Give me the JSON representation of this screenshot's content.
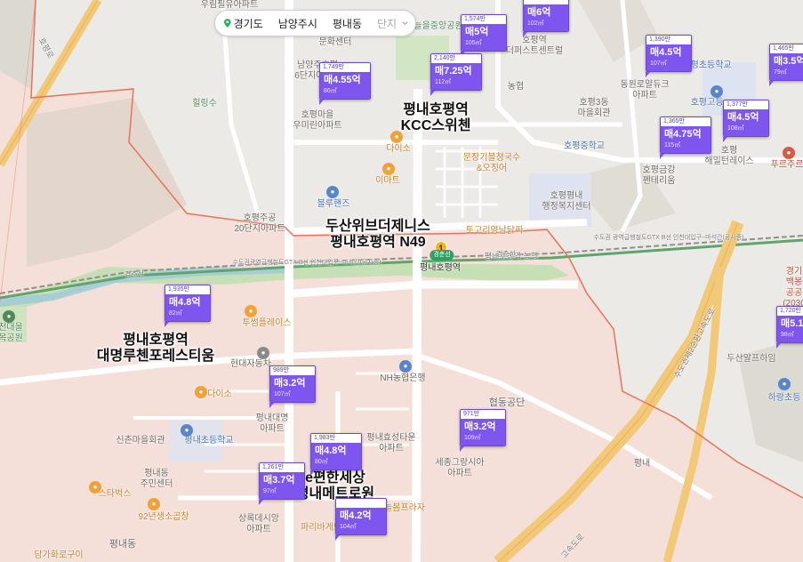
{
  "breadcrumb": {
    "items": [
      "경기도",
      "남양주시",
      "평내동"
    ],
    "complex_select": "단지"
  },
  "colors": {
    "marker": "#7e55ee",
    "boundary": "#e8735c",
    "highway": "#f2c879"
  },
  "complexes": [
    {
      "name": "평내호평역\nKCC스위첸"
    },
    {
      "name": "두산위브더제니스\n평내호평역 N49"
    },
    {
      "name": "평내호평역\n대명루첸포레스티움"
    },
    {
      "name": "e편한세상\n평내메트로원"
    }
  ],
  "listings": [
    {
      "id": "m1",
      "unit": "1,574만",
      "price": "매5억",
      "area": "105㎡"
    },
    {
      "id": "m2",
      "unit": "",
      "price": "매6억",
      "area": "102㎡"
    },
    {
      "id": "m3",
      "unit": "1,749만",
      "price": "매4.55억",
      "area": "86㎡"
    },
    {
      "id": "m4",
      "unit": "2,140만",
      "price": "매7.25억",
      "area": "112㎡"
    },
    {
      "id": "m5",
      "unit": "1,390만",
      "price": "매4.5억",
      "area": "107㎡"
    },
    {
      "id": "m6",
      "unit": "1,465만",
      "price": "매3.5억",
      "area": "79㎡"
    },
    {
      "id": "m7",
      "unit": "1,377만",
      "price": "매4.5억",
      "area": "108㎡"
    },
    {
      "id": "m8",
      "unit": "1,365만",
      "price": "매4.75억",
      "area": "115㎡"
    },
    {
      "id": "m9",
      "unit": "1,935만",
      "price": "매4.8억",
      "area": "82㎡"
    },
    {
      "id": "m10",
      "unit": "1,720만",
      "price": "매5.1",
      "area": "98㎡"
    },
    {
      "id": "m11",
      "unit": "989만",
      "price": "매3.2억",
      "area": "107㎡"
    },
    {
      "id": "m12",
      "unit": "971만",
      "price": "매3.2억",
      "area": "109㎡"
    },
    {
      "id": "m13",
      "unit": "1,983만",
      "price": "매4.8억",
      "area": "80㎡"
    },
    {
      "id": "m14",
      "unit": "1,261만",
      "price": "매3.7억",
      "area": "97㎡"
    },
    {
      "id": "m15",
      "unit": "",
      "price": "매4.2억",
      "area": "104㎡"
    }
  ],
  "places": [
    {
      "text": "우림필유아파트"
    },
    {
      "text": "늘을중앙공원"
    },
    {
      "text": "문화센터"
    },
    {
      "text": "남양주호평\n6단지아파트"
    },
    {
      "text": "호평마을\n우미린아파트"
    },
    {
      "text": "힐링수"
    },
    {
      "text": "호평역\n더퍼스트센트럴"
    },
    {
      "text": "농협"
    },
    {
      "text": "호평3동\n마을회관"
    },
    {
      "text": "동원로얄듀크\n아파트"
    },
    {
      "text": "호평초등학교"
    },
    {
      "text": "호평고등"
    },
    {
      "text": "호평중학교"
    },
    {
      "text": "호평금강\n펜테리움"
    },
    {
      "text": "호평\n해밀턴레이스"
    },
    {
      "text": "다이소"
    },
    {
      "text": "이마트"
    },
    {
      "text": "문장기블쳥국수\n&오징어"
    },
    {
      "text": "블루핸즈"
    },
    {
      "text": "호평평내\n행정복지센터"
    },
    {
      "text": "호평주공\n20단지아파트"
    },
    {
      "text": "토고리영남닭짜"
    },
    {
      "text": "평내호평역"
    },
    {
      "text": "투썸플레이스"
    },
    {
      "text": "현대자동차"
    },
    {
      "text": "다이소"
    },
    {
      "text": "평내대명\n아파트"
    },
    {
      "text": "NH농협은행"
    },
    {
      "text": "평내효성타운\n아파트"
    },
    {
      "text": "협동공단"
    },
    {
      "text": "신촌마을회관"
    },
    {
      "text": "평내초등학교"
    },
    {
      "text": "평내동\n주민센터"
    },
    {
      "text": "세종그랑시아\n아파트"
    },
    {
      "text": "스타벅스"
    },
    {
      "text": "92년생소곱창"
    },
    {
      "text": "상록데시앙\n아파트"
    },
    {
      "text": "파리바게뜨"
    },
    {
      "text": "늘봄프라자"
    },
    {
      "text": "평내동"
    },
    {
      "text": "담가화로구이"
    },
    {
      "text": "두산알프하임"
    },
    {
      "text": "하랑초등"
    },
    {
      "text": "평내"
    },
    {
      "text": "푸르주르"
    },
    {
      "text": "천대울\n목공원"
    },
    {
      "text": "경기\n백봉\n공공\n(2030"
    },
    {
      "text": "구\n장"
    },
    {
      "text": "평내호평역 농행"
    },
    {
      "text": "호평로"
    },
    {
      "text": "수도권광역급행철도GTX B선 인천대입구~마석간(공사중)"
    },
    {
      "text": "수도권 광역급행철도GTX B선 인천대입구~마석간(공사중)"
    },
    {
      "text": "경춘선"
    },
    {
      "text": "경춘선"
    },
    {
      "text": "수도권제2순환고속도로"
    },
    {
      "text": "고속도로"
    }
  ]
}
